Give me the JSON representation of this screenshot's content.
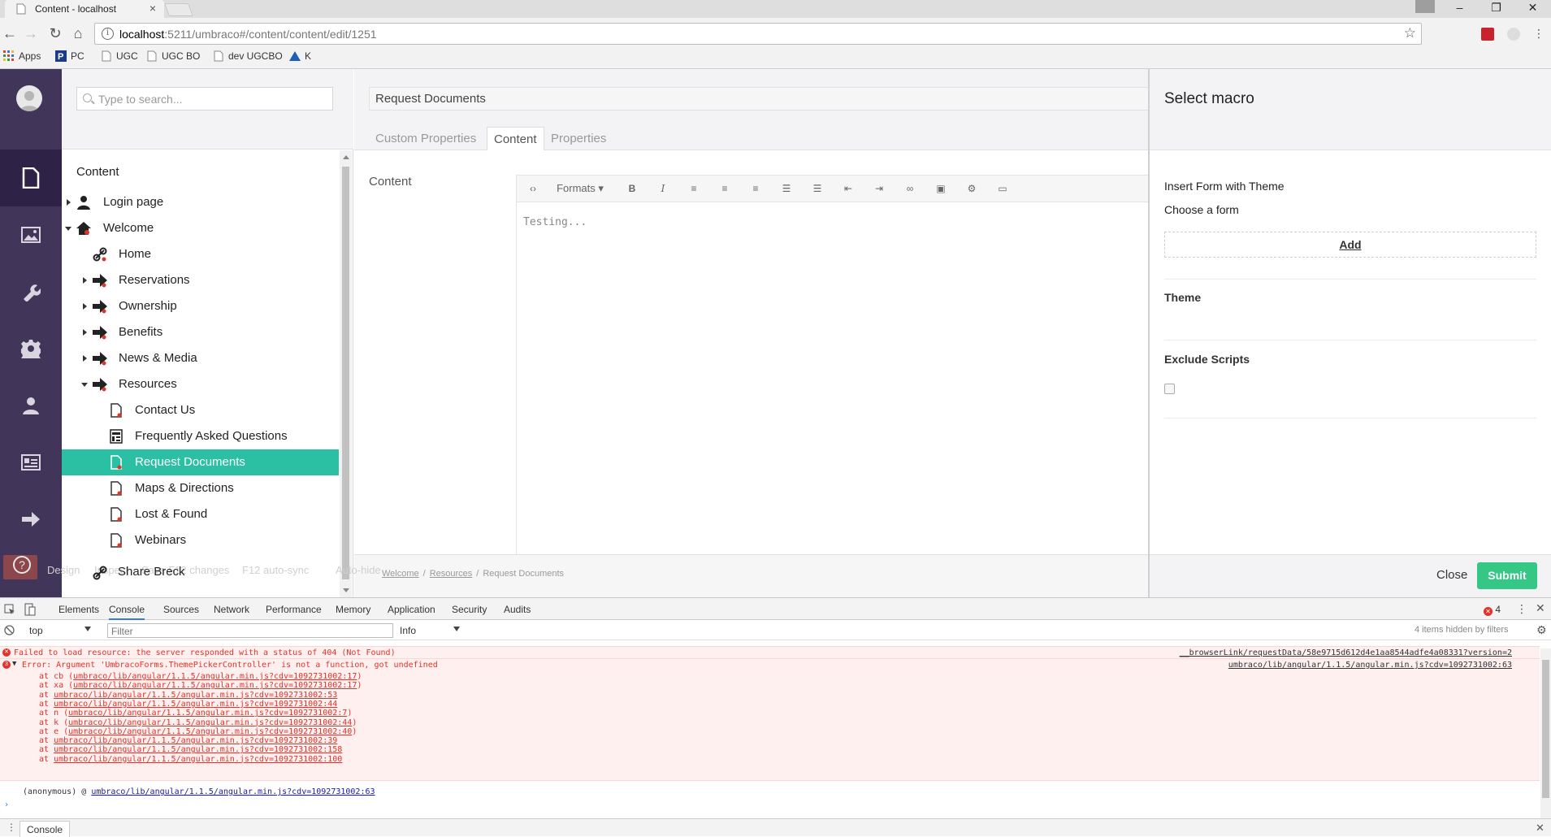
{
  "browser": {
    "tab_title": "Content - localhost",
    "url_host": "localhost",
    "url_rest": ":5211/umbraco#/content/content/edit/1251",
    "bookmarks": [
      "Apps",
      "PC",
      "UGC",
      "UGC BO",
      "dev UGCBO",
      "K"
    ]
  },
  "search": {
    "placeholder": "Type to search..."
  },
  "tree": {
    "header": "Content",
    "nodes": [
      "Login page",
      "Welcome",
      "Home",
      "Reservations",
      "Ownership",
      "Benefits",
      "News & Media",
      "Resources",
      "Contact Us",
      "Frequently Asked Questions",
      "Request Documents",
      "Maps & Directions",
      "Lost & Found",
      "Webinars"
    ],
    "share": "Share Breck"
  },
  "editor": {
    "doc_name": "Request Documents",
    "tabs": [
      "Custom Properties",
      "Content",
      "Properties"
    ],
    "active_tab": "Content",
    "content_label": "Content",
    "formats_label": "Formats",
    "body_text": "Testing...",
    "breadcrumb": [
      "Welcome",
      "Resources",
      "Request Documents"
    ]
  },
  "ghost": {
    "design": "Design",
    "inspect": "Inspect",
    "save": "Save F12 changes",
    "f12": "F12 auto-sync",
    "autohide": "Auto-hide"
  },
  "macro": {
    "title": "Select macro",
    "section": "Insert Form with Theme",
    "choose_form": "Choose a form",
    "add": "Add",
    "theme": "Theme",
    "exclude": "Exclude Scripts",
    "close": "Close",
    "submit": "Submit"
  },
  "devtools": {
    "tabs": [
      "Elements",
      "Console",
      "Sources",
      "Network",
      "Performance",
      "Memory",
      "Application",
      "Security",
      "Audits"
    ],
    "active_tab": "Console",
    "error_count": "4",
    "context": "top",
    "filter_placeholder": "Filter",
    "level": "Info",
    "hidden": "4 items hidden by filters",
    "msg1": "Failed to load resource: the server responded with a status of 404 (Not Found)",
    "msg1_src": "__browserLink/requestData/58e9715d612d4e1aa8544adfe4a08331?version=2",
    "msg2_count": "3",
    "msg2": "Error: Argument 'UmbracoForms.ThemePickerController' is not a function, got undefined",
    "msg2_src": "umbraco/lib/angular/1.1.5/angular.min.js?cdv=1092731002:63",
    "stack": [
      {
        "fn": "cb",
        "loc": "umbraco/lib/angular/1.1.5/angular.min.js?cdv=1092731002:17"
      },
      {
        "fn": "xa",
        "loc": "umbraco/lib/angular/1.1.5/angular.min.js?cdv=1092731002:17"
      },
      {
        "fn": "",
        "loc": "umbraco/lib/angular/1.1.5/angular.min.js?cdv=1092731002:53"
      },
      {
        "fn": "",
        "loc": "umbraco/lib/angular/1.1.5/angular.min.js?cdv=1092731002:44"
      },
      {
        "fn": "n",
        "loc": "umbraco/lib/angular/1.1.5/angular.min.js?cdv=1092731002:7"
      },
      {
        "fn": "k",
        "loc": "umbraco/lib/angular/1.1.5/angular.min.js?cdv=1092731002:44"
      },
      {
        "fn": "e",
        "loc": "umbraco/lib/angular/1.1.5/angular.min.js?cdv=1092731002:40"
      },
      {
        "fn": "",
        "loc": "umbraco/lib/angular/1.1.5/angular.min.js?cdv=1092731002:39"
      },
      {
        "fn": "",
        "loc": "umbraco/lib/angular/1.1.5/angular.min.js?cdv=1092731002:158"
      },
      {
        "fn": "",
        "loc": "umbraco/lib/angular/1.1.5/angular.min.js?cdv=1092731002:100"
      }
    ],
    "anon_prefix": "(anonymous) @",
    "anon_loc": "umbraco/lib/angular/1.1.5/angular.min.js?cdv=1092731002:63",
    "drawer_tab": "Console"
  },
  "colors": {
    "appbar": "#413659",
    "selected": "#2bc0a4",
    "submit": "#35c786",
    "error": "#e0332a"
  }
}
